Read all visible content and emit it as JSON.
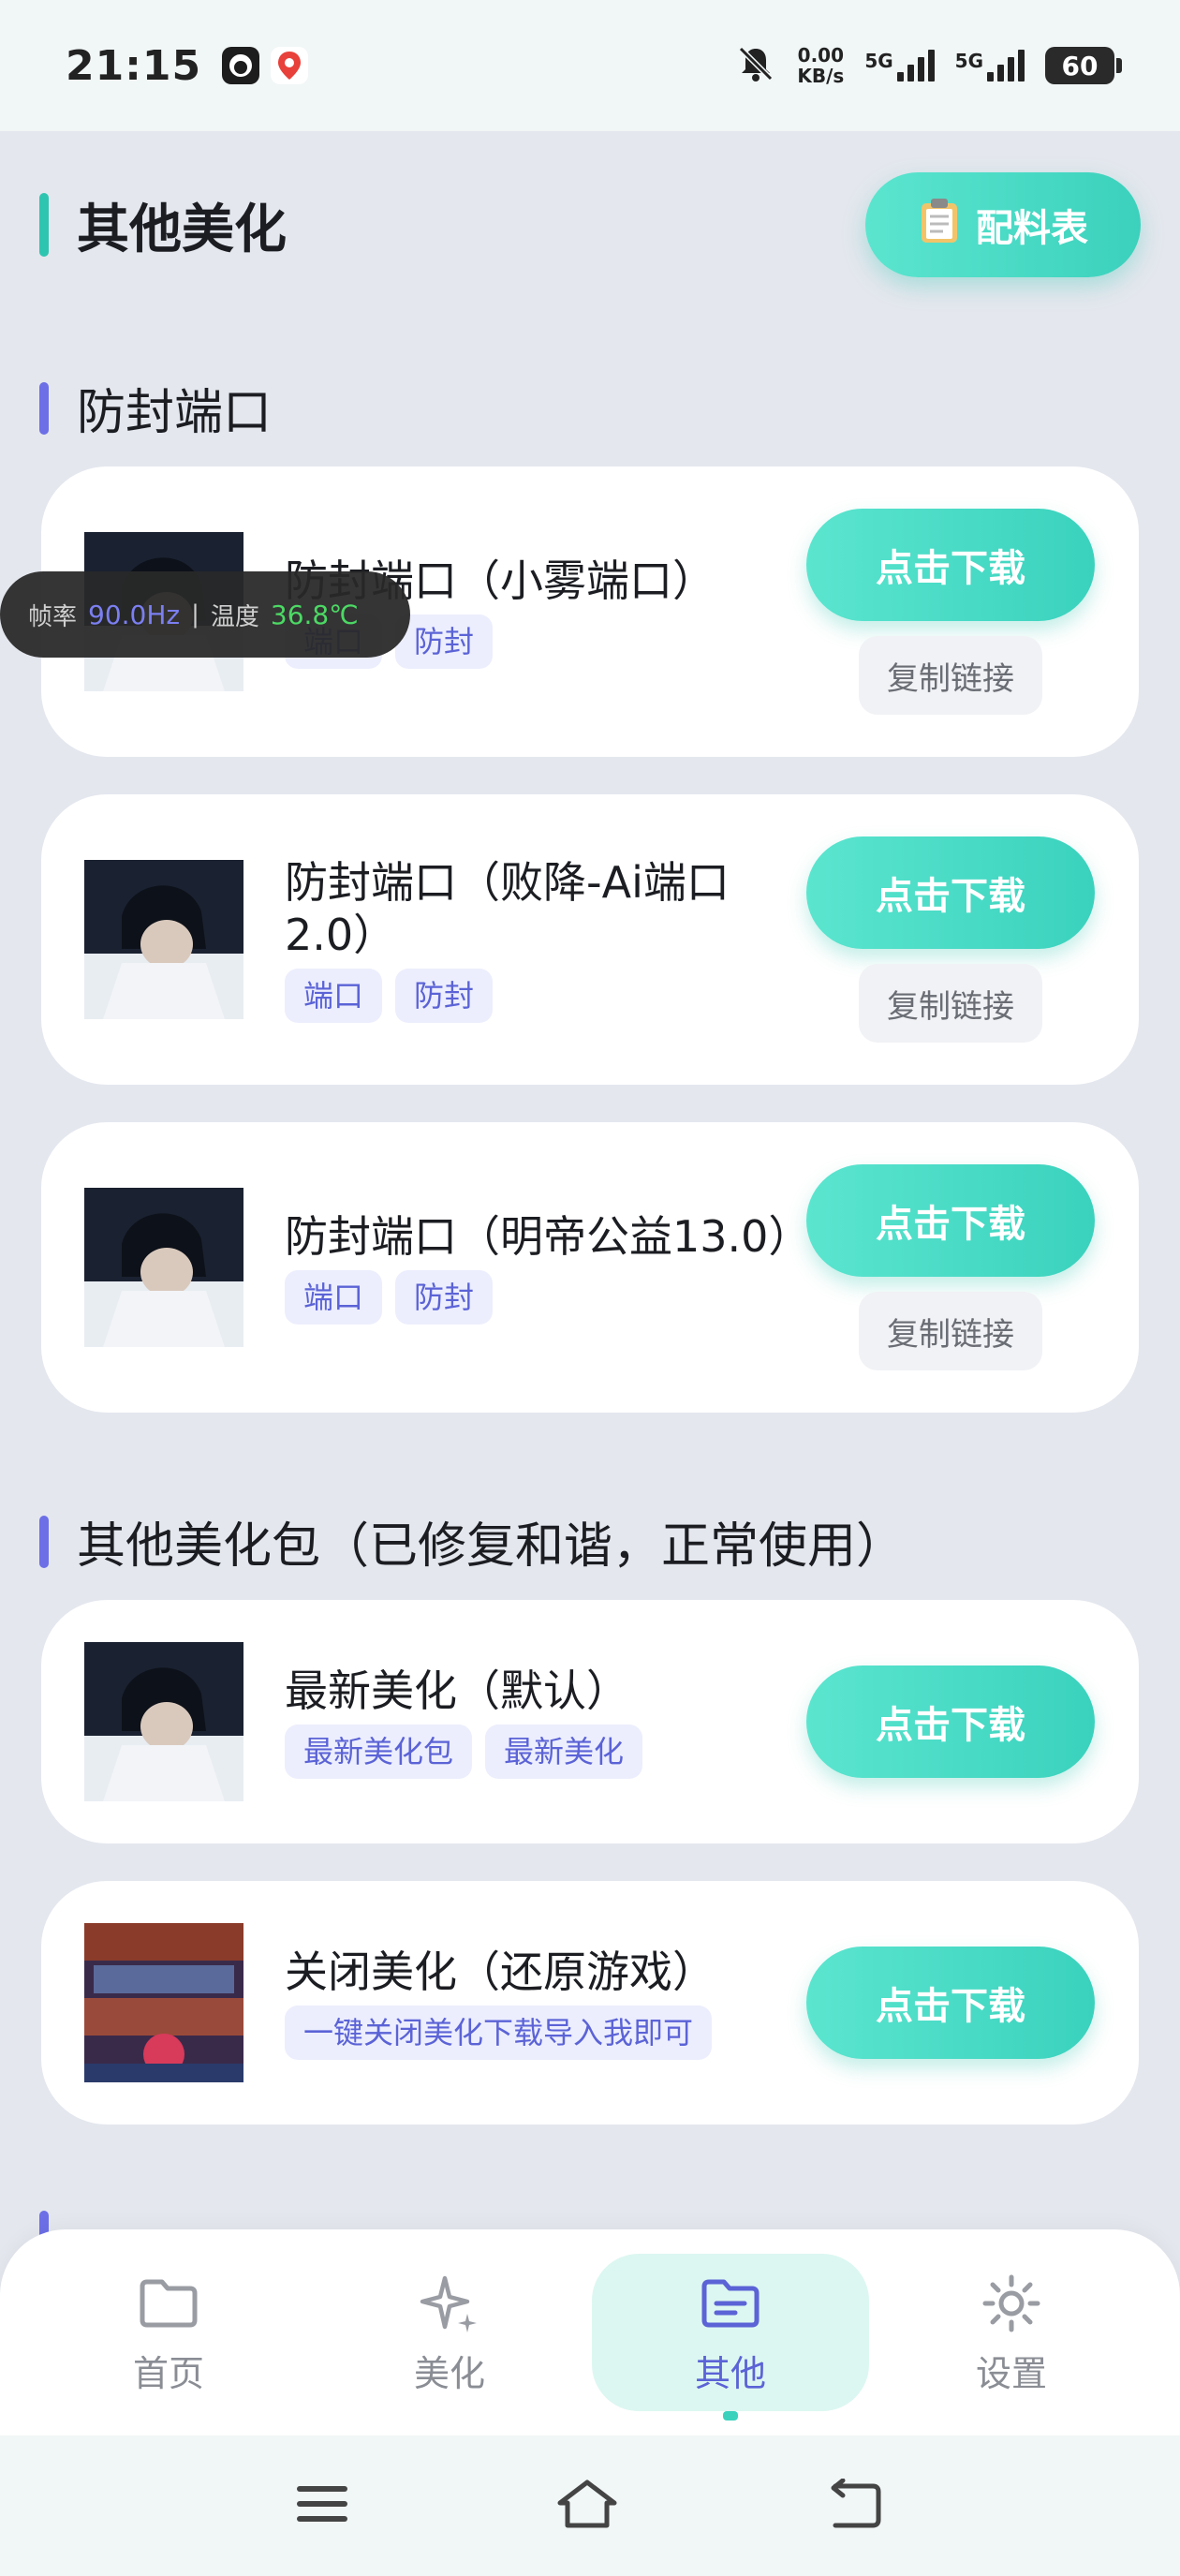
{
  "status_bar": {
    "time": "21:15",
    "speed_value": "0.00",
    "speed_unit": "KB/s",
    "net1": "5G",
    "net2": "5G",
    "battery": "60"
  },
  "header": {
    "title": "其他美化",
    "recipe_label": "配料表"
  },
  "overlay": {
    "fps_label": "帧率",
    "fps_value": "90.0Hz",
    "separator": "|",
    "temp_label": "温度",
    "temp_value": "36.8℃"
  },
  "sections": [
    {
      "title": "防封端口",
      "items": [
        {
          "title": "防封端口（小雾端口）",
          "tags": [
            "端口",
            "防封"
          ],
          "download": "点击下载",
          "copy": "复制链接"
        },
        {
          "title": "防封端口（败降-Ai端口2.0）",
          "tags": [
            "端口",
            "防封"
          ],
          "download": "点击下载",
          "copy": "复制链接"
        },
        {
          "title": "防封端口（明帝公益13.0）",
          "tags": [
            "端口",
            "防封"
          ],
          "download": "点击下载",
          "copy": "复制链接"
        }
      ]
    },
    {
      "title": "其他美化包（已修复和谐，正常使用）",
      "items": [
        {
          "title": "最新美化（默认）",
          "tags": [
            "最新美化包",
            "最新美化"
          ],
          "download": "点击下载"
        },
        {
          "title": "关闭美化（还原游戏）",
          "tags": [
            "一键关闭美化下载导入我即可"
          ],
          "download": "点击下载"
        }
      ]
    }
  ],
  "bottom_nav": [
    {
      "label": "首页",
      "icon": "folder-icon"
    },
    {
      "label": "美化",
      "icon": "sparkle-icon"
    },
    {
      "label": "其他",
      "icon": "document-folder-icon",
      "active": true
    },
    {
      "label": "设置",
      "icon": "sun-gear-icon"
    }
  ],
  "colors": {
    "accent_teal": "#3ad2bd",
    "accent_purple": "#5b63d6",
    "background": "#e4e7ee"
  }
}
